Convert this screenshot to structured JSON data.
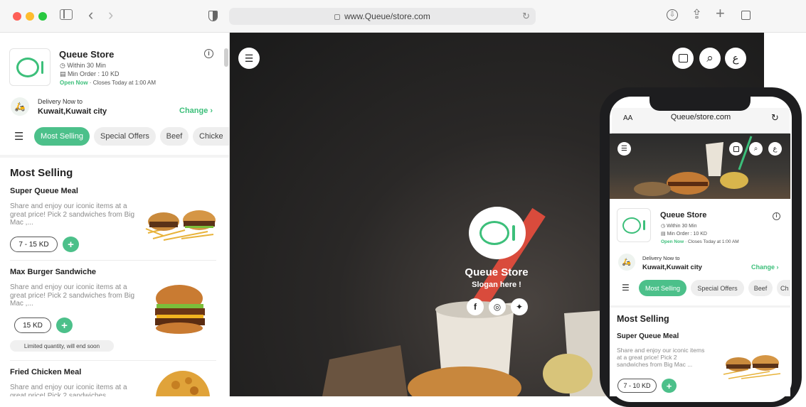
{
  "browser": {
    "url": "www.Queue/store.com",
    "dot_colors": [
      "#fe5f57",
      "#febc2e",
      "#28c840"
    ]
  },
  "store": {
    "name": "Queue Store",
    "delivery_time": "Within 30 Min",
    "min_order": "Min Order : 10 KD",
    "status": "Open Now",
    "closes": "Closes Today at 1:00 AM",
    "delivery_label": "Delivery Now to",
    "location": "Kuwait,Kuwait city",
    "change": "Change",
    "accent": "#4cc08a"
  },
  "tabs": [
    "Most Selling",
    "Special Offers",
    "Beef",
    "Chicke"
  ],
  "section_title": "Most Selling",
  "items": [
    {
      "name": "Super Queue Meal",
      "desc": "Share and enjoy our iconic items at a great price! Pick 2 sandwiches from Big Mac ,...",
      "price": "7 - 15 KD"
    },
    {
      "name": "Max Burger Sandwiche",
      "desc": "Share and enjoy our iconic items at a great price! Pick 2 sandwiches from Big Mac ,...",
      "price": "15 KD",
      "tag": "Limited quantity, will end soon"
    },
    {
      "name": "Fried Chicken Meal",
      "desc": "Share and enjoy our iconic items at a great price! Pick 2 sandwiches"
    }
  ],
  "hero": {
    "title": "Queue Store",
    "slogan": "Slogan here !",
    "lang_glyph": "ع",
    "social": [
      "facebook-icon",
      "instagram-icon",
      "twitter-icon"
    ]
  },
  "phone": {
    "aa": "AA",
    "url": "Queue/store.com",
    "store_name": "Queue Store",
    "delivery_time": "Within 30 Min",
    "min_order": "Min Order : 10 KD",
    "status": "Open Now",
    "closes": "Closes Today at 1:00 AM",
    "delivery_label": "Delivery Now to",
    "location": "Kuwait,Kuwait city",
    "change": "Change",
    "tabs": [
      "Most Selling",
      "Special Offers",
      "Beef",
      "Ch"
    ],
    "section_title": "Most Selling",
    "item_name": "Super Queue Meal",
    "item_desc": "Share and enjoy our iconic items at a great price! Pick 2 sandwiches from Big Mac ...",
    "item_price": "7 - 10 KD"
  },
  "icons": {
    "plus": "+",
    "chevron": "›",
    "back": "‹",
    "forward": "›",
    "menu": "☰",
    "search": "⌕",
    "download": "⇩",
    "share": "⇪",
    "add_tab": "+",
    "reload": "↻",
    "info": "i",
    "clock": "◷",
    "receipt": "▤",
    "facebook": "f",
    "instagram": "◎",
    "twitter": "✦",
    "sep": "·"
  }
}
